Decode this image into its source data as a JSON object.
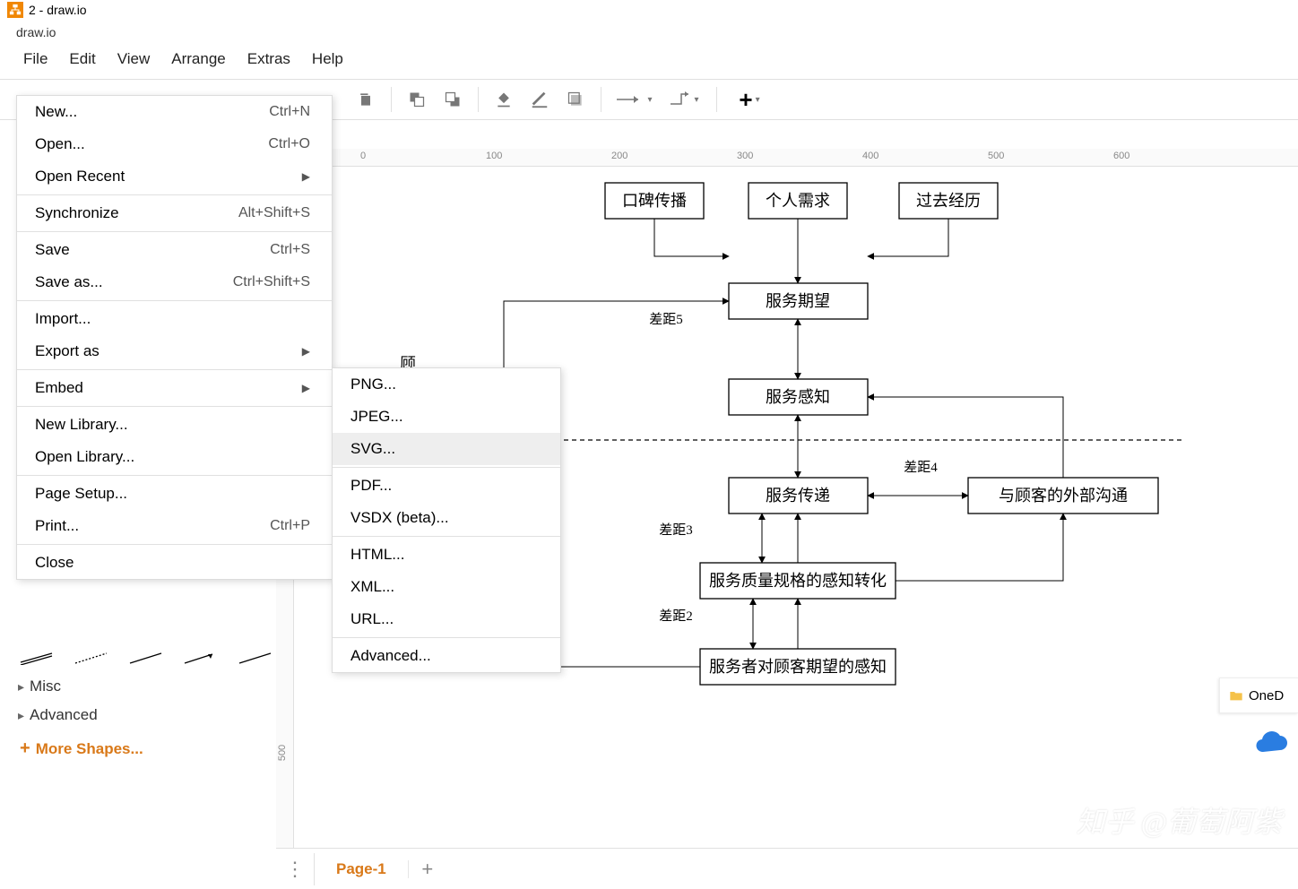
{
  "window": {
    "title": "2 - draw.io",
    "subtitle": "draw.io"
  },
  "menubar": [
    "File",
    "Edit",
    "View",
    "Arrange",
    "Extras",
    "Help"
  ],
  "file_menu": {
    "new": "New...",
    "new_sc": "Ctrl+N",
    "open": "Open...",
    "open_sc": "Ctrl+O",
    "open_recent": "Open Recent",
    "sync": "Synchronize",
    "sync_sc": "Alt+Shift+S",
    "save": "Save",
    "save_sc": "Ctrl+S",
    "save_as": "Save as...",
    "save_as_sc": "Ctrl+Shift+S",
    "import": "Import...",
    "export_as": "Export as",
    "embed": "Embed",
    "new_lib": "New Library...",
    "open_lib": "Open Library...",
    "page_setup": "Page Setup...",
    "print": "Print...",
    "print_sc": "Ctrl+P",
    "close": "Close"
  },
  "export_submenu": {
    "png": "PNG...",
    "jpeg": "JPEG...",
    "svg": "SVG...",
    "pdf": "PDF...",
    "vsdx": "VSDX (beta)...",
    "html": "HTML...",
    "xml": "XML...",
    "url": "URL...",
    "advanced": "Advanced..."
  },
  "sidebar": {
    "misc": "Misc",
    "advanced": "Advanced",
    "more_shapes": "More Shapes..."
  },
  "page_tab": "Page-1",
  "ruler_h": [
    "0",
    "100",
    "200",
    "300",
    "400",
    "500",
    "600"
  ],
  "ruler_v": "500",
  "onedrive": "OneD",
  "diagram": {
    "nodes": {
      "wom": "口碑传播",
      "personal": "个人需求",
      "past": "过去经历",
      "exp": "服务期望",
      "per": "服务感知",
      "del": "服务传递",
      "transform": "服务质量规格的感知转化",
      "provider": "服务者对顾客期望的感知",
      "ext": "与顾客的外部沟通"
    },
    "labels": {
      "g5": "差距5",
      "g4": "差距4",
      "g3": "差距3",
      "g2": "差距2"
    },
    "partial": "顾"
  },
  "watermark": "知乎 @葡萄阿紫"
}
